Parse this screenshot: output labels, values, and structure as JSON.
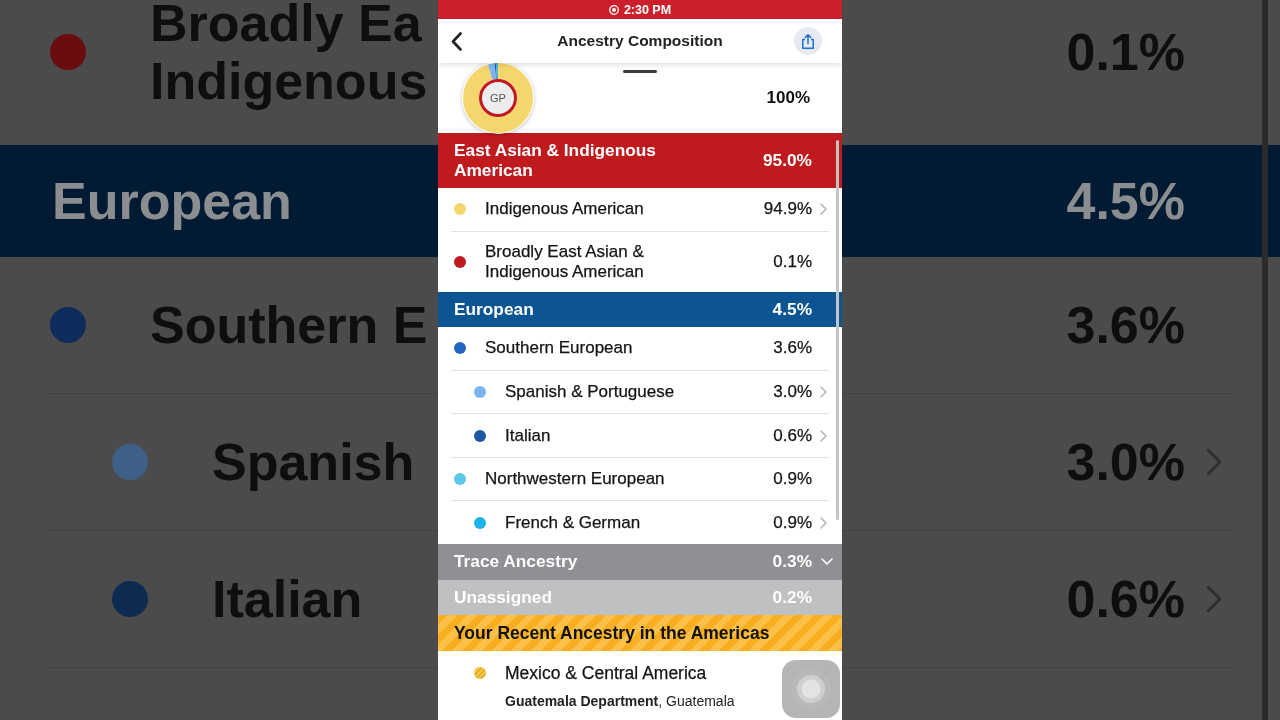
{
  "backdrop": {
    "rows": [
      {
        "kind": "entry",
        "label_lines": [
          "Broadly Ea",
          "Indigenous"
        ],
        "percent": "0.1%",
        "color": "#6a0b0d",
        "disclosure": false
      },
      {
        "kind": "band",
        "label": "European",
        "percent": "4.5%",
        "color": "#021b33"
      },
      {
        "kind": "entry",
        "label_lines": [
          "Southern E"
        ],
        "percent": "3.6%",
        "color": "#0f2d5c",
        "disclosure": false,
        "children": [
          {
            "kind": "entry",
            "label_lines": [
              "Spanish"
            ],
            "percent": "3.0%",
            "color": "#3e5f88",
            "disclosure": true
          },
          {
            "kind": "entry",
            "label_lines": [
              "Italian"
            ],
            "percent": "0.6%",
            "color": "#0e2b52",
            "disclosure": true
          }
        ]
      }
    ]
  },
  "status_bar": {
    "time": "2:30 PM",
    "recording": true
  },
  "header": {
    "title": "Ancestry Composition"
  },
  "summary": {
    "initials": "GP",
    "percent": "100%"
  },
  "groups": [
    {
      "label": "East Asian & Indigenous American",
      "percent": "95.0%",
      "color": "#bf1b1f",
      "rows": [
        {
          "label": "Indigenous American",
          "percent": "94.9%",
          "color": "#f5d66c",
          "disclosure": true
        },
        {
          "label": "Broadly East Asian & Indigenous American",
          "percent": "0.1%",
          "color": "#c0191f",
          "disclosure": false
        }
      ]
    },
    {
      "label": "European",
      "percent": "4.5%",
      "color": "#0c5592",
      "rows": [
        {
          "label": "Southern European",
          "percent": "3.6%",
          "color": "#2367c2",
          "disclosure": false,
          "children": [
            {
              "label": "Spanish & Portuguese",
              "percent": "3.0%",
              "color": "#7db5f0",
              "disclosure": true
            },
            {
              "label": "Italian",
              "percent": "0.6%",
              "color": "#1d58a0",
              "disclosure": true
            }
          ]
        },
        {
          "label": "Northwestern European",
          "percent": "0.9%",
          "color": "#5ec8e8",
          "disclosure": false,
          "children": [
            {
              "label": "French & German",
              "percent": "0.9%",
              "color": "#1cb4e6",
              "disclosure": true
            }
          ]
        }
      ]
    },
    {
      "label": "Trace Ancestry",
      "percent": "0.3%",
      "color": "#8e9093",
      "expanded": false
    },
    {
      "label": "Unassigned",
      "percent": "0.2%",
      "color": "#bfc0c2"
    }
  ],
  "americas": {
    "title": "Your Recent Ancestry in the Americas",
    "rows": [
      {
        "label": "Mexico & Central America",
        "detail": "**Guatemala Department**, Guatemala",
        "color": "#f5c744",
        "disclosure": true
      }
    ]
  }
}
